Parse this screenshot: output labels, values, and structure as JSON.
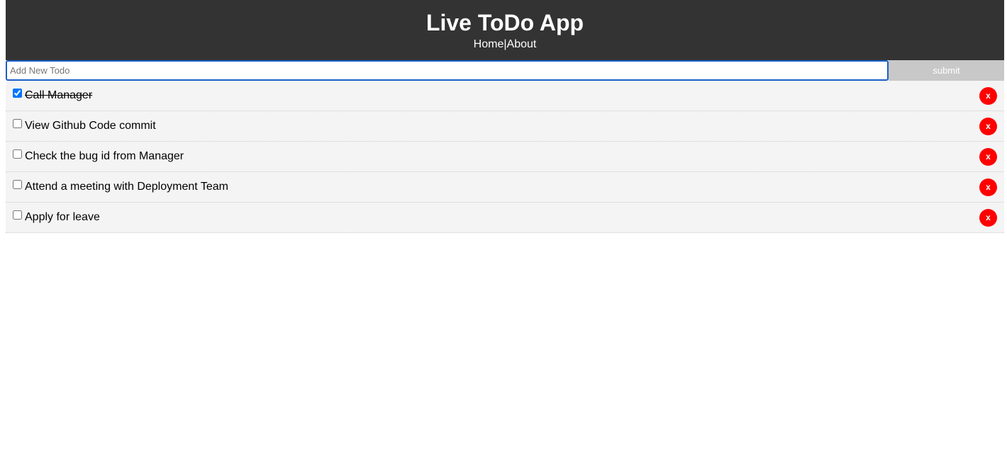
{
  "header": {
    "title": "Live ToDo App",
    "nav": {
      "home": "Home",
      "separator": "|",
      "about": "About"
    }
  },
  "form": {
    "input_value": "",
    "input_placeholder": "Add New Todo",
    "submit_label": "submit"
  },
  "todos": [
    {
      "title": "Call Manager",
      "completed": true,
      "delete_label": "x"
    },
    {
      "title": "View Github Code commit",
      "completed": false,
      "delete_label": "x"
    },
    {
      "title": "Check the bug id from Manager",
      "completed": false,
      "delete_label": "x"
    },
    {
      "title": "Attend a meeting with Deployment Team",
      "completed": false,
      "delete_label": "x"
    },
    {
      "title": "Apply for leave",
      "completed": false,
      "delete_label": "x"
    }
  ],
  "colors": {
    "header_bg": "#333333",
    "delete_button": "#ff0000",
    "submit_button": "#c8c8c8",
    "item_bg": "#f4f4f4",
    "input_focus_border": "#1a5fc7"
  }
}
